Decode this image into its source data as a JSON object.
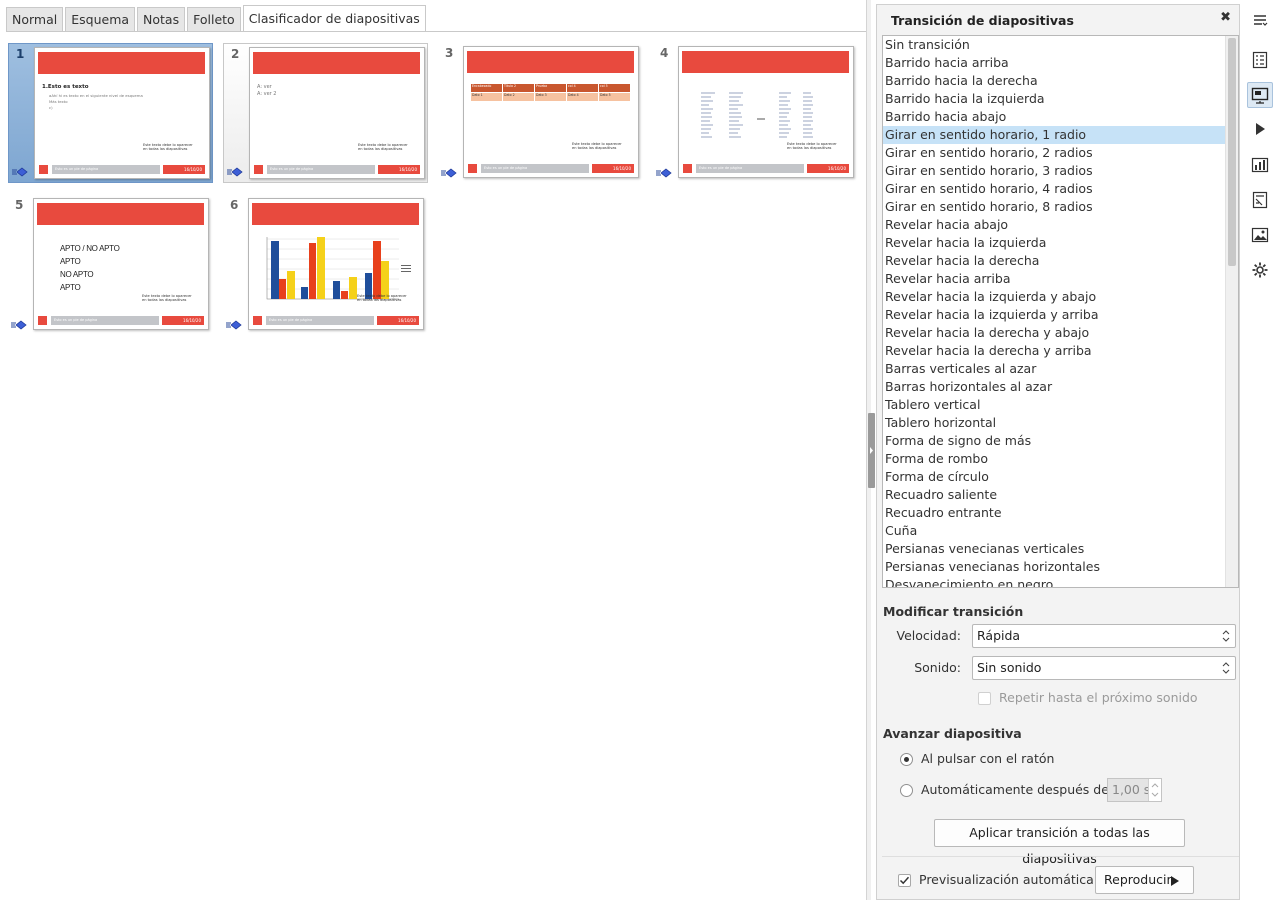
{
  "tabs": [
    {
      "label": "Normal"
    },
    {
      "label": "Esquema"
    },
    {
      "label": "Notas"
    },
    {
      "label": "Folleto"
    },
    {
      "label": "Clasificador de diapositivas"
    }
  ],
  "slides": [
    {
      "num": "1",
      "title": "1.Esto es texto",
      "lines": [
        "aAhí hi es texto en el siguiente nivel de esquema",
        "Más texto",
        "c)"
      ],
      "footer": "Esto es un pie de página",
      "date": "16/10/20",
      "note": "Este texto debe lo aparecer en todas las diapositivas"
    },
    {
      "num": "2",
      "lines": [
        "A: ver",
        "A: ver 2"
      ],
      "footer": "Esto es un pie de página",
      "date": "16/10/20",
      "note": "Este texto debe lo aparecer en todas las diapositivas"
    },
    {
      "num": "3",
      "table_head": [
        "Encabezado",
        "Título 2",
        "Prueba",
        "col 4",
        "col 5"
      ],
      "table_row": [
        "Dato 1",
        "Dato 2",
        "Dato 3",
        "Dato 4",
        "Dato 5"
      ],
      "footer": "Esto es un pie de página",
      "date": "16/10/20",
      "note": "Este texto debe lo aparecer en todas las diapositivas"
    },
    {
      "num": "4",
      "footer": "Esto es un pie de página",
      "date": "16/10/20",
      "note": "Este texto debe lo aparecer en todas las diapositivas"
    },
    {
      "num": "5",
      "lines": [
        "APTO / NO APTO",
        "APTO",
        "NO APTO",
        "APTO"
      ],
      "footer": "Esto es un pie de página",
      "date": "16/10/20",
      "note": "Este texto debe lo aparecer en todas las diapositivas"
    },
    {
      "num": "6",
      "footer": "Esto es un pie de página",
      "date": "16/10/20",
      "note": "Este texto debe lo aparecer en todas las diapositivas"
    }
  ],
  "panel": {
    "title": "Transición de diapositivas",
    "transitions": [
      "Sin transición",
      "Barrido hacia arriba",
      "Barrido hacia la derecha",
      "Barrido hacia la izquierda",
      "Barrido hacia abajo",
      "Girar en sentido horario, 1 radio",
      "Girar en sentido horario, 2 radios",
      "Girar en sentido horario, 3 radios",
      "Girar en sentido horario, 4 radios",
      "Girar en sentido horario, 8 radios",
      "Revelar hacia abajo",
      "Revelar hacia la izquierda",
      "Revelar hacia la derecha",
      "Revelar hacia arriba",
      "Revelar hacia la izquierda y abajo",
      "Revelar hacia la izquierda y arriba",
      "Revelar hacia la derecha y abajo",
      "Revelar hacia la derecha y arriba",
      "Barras verticales al azar",
      "Barras horizontales al azar",
      "Tablero vertical",
      "Tablero horizontal",
      "Forma de signo de más",
      "Forma de rombo",
      "Forma de círculo",
      "Recuadro saliente",
      "Recuadro entrante",
      "Cuña",
      "Persianas venecianas verticales",
      "Persianas venecianas horizontales",
      "Desvanecimiento en negro"
    ],
    "selected_transition": "Girar en sentido horario, 1 radio",
    "modify_title": "Modificar transición",
    "speed_label": "Velocidad:",
    "speed_value": "Rápida",
    "sound_label": "Sonido:",
    "sound_value": "Sin sonido",
    "loop_label": "Repetir hasta el próximo sonido",
    "advance_title": "Avanzar diapositiva",
    "on_click_label": "Al pulsar con el ratón",
    "auto_label": "Automáticamente después de:",
    "auto_value": "1,00 s",
    "apply_all_label": "Aplicar transición a todas las diapositivas",
    "autopreview_label": "Previsualización automática",
    "play_label": "Reproducir"
  },
  "colors": {
    "accent_red": "#e84a3e",
    "selection_blue": "#c6e2f7"
  }
}
